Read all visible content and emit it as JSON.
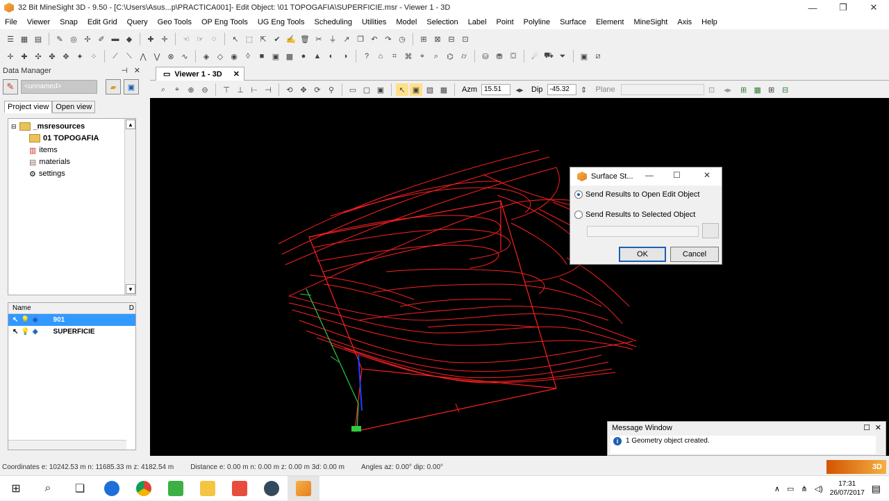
{
  "window": {
    "title": "32 Bit MineSight 3D - 9.50 - [C:\\Users\\Asus...p\\PRACTICA001]- Edit Object: \\01 TOPOGAFIA\\SUPERFICIE.msr - Viewer 1 - 3D",
    "minimize": "—",
    "maximize": "❐",
    "close": "✕"
  },
  "menu": [
    "File",
    "Viewer",
    "Snap",
    "Edit Grid",
    "Query",
    "Geo Tools",
    "OP Eng Tools",
    "UG Eng Tools",
    "Scheduling",
    "Utilities",
    "Model",
    "Selection",
    "Label",
    "Point",
    "Polyline",
    "Surface",
    "Element",
    "MineSight",
    "Axis",
    "Help"
  ],
  "data_manager": {
    "title": "Data Manager",
    "pin": "⊣",
    "close": "✕",
    "object_name": "<unnamed>",
    "tabs": [
      "Project view",
      "Open view"
    ],
    "tree": [
      {
        "label": "_msresources",
        "bold": true
      },
      {
        "label": "01 TOPOGAFIA",
        "bold": true
      },
      {
        "label": "items",
        "bold": false
      },
      {
        "label": "materials",
        "bold": false
      },
      {
        "label": "settings",
        "bold": false
      }
    ],
    "list_header": {
      "name": "Name",
      "extra": "D"
    },
    "list_items": [
      {
        "label": "901",
        "selected": true
      },
      {
        "label": "SUPERFICIE",
        "selected": false
      }
    ]
  },
  "viewer": {
    "tab_label": "Viewer 1 - 3D",
    "azm_label": "Azm",
    "azm_value": "15.51",
    "dip_label": "Dip",
    "dip_value": "-45.32",
    "plane_label": "Plane"
  },
  "dialog": {
    "title": "Surface St...",
    "option_open": "Send Results to Open Edit Object",
    "option_selected": "Send Results to Selected Object",
    "selected_option": "open",
    "ok": "OK",
    "cancel": "Cancel"
  },
  "message_window": {
    "title": "Message Window",
    "message": "1 Geometry object created."
  },
  "status": {
    "coordinates": "Coordinates  e: 10242.53 m  n: 11685.33 m  z: 4182.54 m",
    "distance": "Distance  e: 0.00 m  n: 0.00 m  z: 0.00 m  3d: 0.00 m",
    "angles": "Angles  az:  0.00°  dip:  0.00°",
    "logo": "3D"
  },
  "taskbar": {
    "time": "17:31",
    "date": "26/07/2017"
  },
  "colors": {
    "contour": "#ff2020",
    "selection": "#3399ff",
    "accent": "#1a5fb4"
  }
}
